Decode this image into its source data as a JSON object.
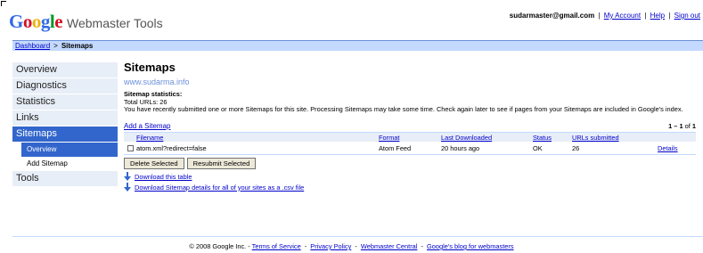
{
  "header": {
    "logo": {
      "letters": [
        "G",
        "o",
        "o",
        "g",
        "l",
        "e"
      ],
      "colors": [
        "#3369e8",
        "#d50f25",
        "#eeb211",
        "#3369e8",
        "#009925",
        "#d50f25"
      ],
      "product": "Webmaster Tools"
    },
    "account": {
      "email": "sudarmaster@gmail.com",
      "my_account": "My Account",
      "help": "Help",
      "sign_out": "Sign out",
      "separator": "|"
    }
  },
  "breadcrumb": {
    "dashboard": "Dashboard",
    "separator": ">",
    "current": "Sitemaps"
  },
  "sidebar": {
    "items": [
      {
        "label": "Overview",
        "active": false
      },
      {
        "label": "Diagnostics",
        "active": false
      },
      {
        "label": "Statistics",
        "active": false
      },
      {
        "label": "Links",
        "active": false
      },
      {
        "label": "Sitemaps",
        "active": true
      },
      {
        "label": "Tools",
        "active": false
      }
    ],
    "subitems": [
      {
        "label": "Overview",
        "active": true
      },
      {
        "label": "Add Sitemap",
        "active": false
      }
    ]
  },
  "main": {
    "title": "Sitemaps",
    "site_url": "www.sudarma.info",
    "stats_label": "Sitemap statistics:",
    "total_urls": "Total URLs: 26",
    "notice": "You have recently submitted one or more Sitemaps for this site. Processing Sitemaps may take some time. Check again later to see if pages from your Sitemaps are included in Google's index.",
    "add_sitemap": "Add a Sitemap",
    "pager": {
      "range": "1 – 1",
      "of": "of",
      "total": "1"
    }
  },
  "table": {
    "headers": {
      "filename": "Filename",
      "format": "Format",
      "last_downloaded": "Last Downloaded",
      "status": "Status",
      "urls_submitted": "URLs submitted"
    },
    "rows": [
      {
        "filename": "atom.xml?redirect=false",
        "format": "Atom Feed",
        "last_downloaded": "20 hours ago",
        "status": "OK",
        "urls_submitted": "26",
        "details": "Details"
      }
    ]
  },
  "actions": {
    "delete_selected": "Delete Selected",
    "resubmit_selected": "Resubmit Selected",
    "download_table": "Download this table",
    "download_csv": "Download Sitemap details for all of your sites as a .csv file"
  },
  "footer": {
    "copyright": "© 2008 Google Inc. -",
    "links": [
      "Terms of Service",
      "Privacy Policy",
      "Webmaster Central",
      "Google's blog for webmasters"
    ],
    "separator": "-"
  },
  "colors": {
    "link": "#0000cc",
    "nav_active": "#3366cc",
    "nav_bg": "#e8eef7",
    "crumb_bg": "#c3d9ff",
    "site_url": "#6b90da"
  }
}
